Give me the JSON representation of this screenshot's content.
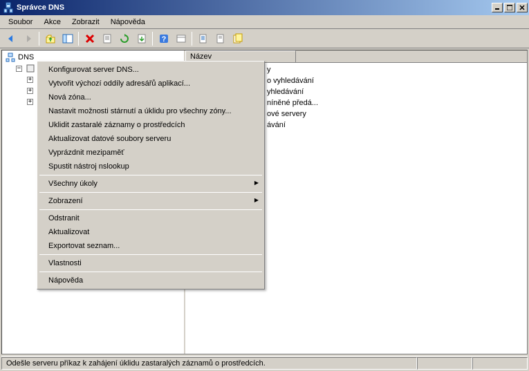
{
  "window": {
    "title": "Správce DNS",
    "min": "_",
    "max": "□",
    "close": "×"
  },
  "menu": {
    "file": "Soubor",
    "action": "Akce",
    "view": "Zobrazit",
    "help": "Nápověda"
  },
  "tree_header": "",
  "list_header": "Název",
  "tree": {
    "root": "DNS"
  },
  "list_items": [
    "y",
    "o vyhledávání",
    "yhledávání",
    "níněné předá...",
    "ové servery",
    "ávání"
  ],
  "context_menu": {
    "configure": "Konfigurovat server DNS...",
    "create_partitions": "Vytvořit výchozí oddíly adresářů aplikací...",
    "new_zone": "Nová zóna...",
    "set_aging": "Nastavit možnosti stárnutí a úklidu pro všechny zóny...",
    "scavenge": "Uklidit zastaralé záznamy o prostředcích",
    "update_files": "Aktualizovat datové soubory serveru",
    "clear_cache": "Vyprázdnit mezipaměť",
    "nslookup": "Spustit nástroj nslookup",
    "all_tasks": "Všechny úkoly",
    "view": "Zobrazení",
    "delete": "Odstranit",
    "refresh": "Aktualizovat",
    "export": "Exportovat seznam...",
    "properties": "Vlastnosti",
    "help": "Nápověda"
  },
  "status": "Odešle serveru příkaz k zahájení úklidu zastaralých záznamů o prostředcích."
}
